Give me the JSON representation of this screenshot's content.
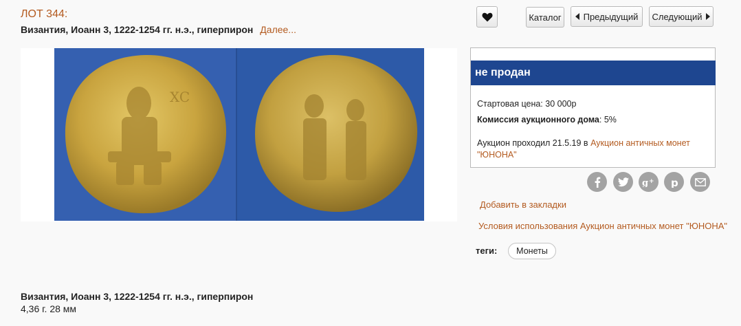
{
  "lot": {
    "number_label": "ЛОТ 344:",
    "title": "Византия, Иоанн 3, 1222-1254 гг. н.э., гиперпирон",
    "more_link": "Далее..."
  },
  "nav": {
    "catalog": "Каталог",
    "previous": "Предыдущий",
    "next": "Следующий",
    "favorite_icon": "heart-icon"
  },
  "status": {
    "label": "не продан",
    "start_price_label": "Стартовая цена:",
    "start_price_value": "30 000р",
    "commission_label": "Комиссия аукционного дома",
    "commission_value": ": 5%",
    "auction_text": "Аукцион проходил 21.5.19 в",
    "auction_link_line1": "Аукцион античных монет",
    "auction_link_line2": "\"ЮНОНА\""
  },
  "social": [
    "facebook-icon",
    "twitter-icon",
    "google-plus-icon",
    "pinterest-icon",
    "email-icon"
  ],
  "links": {
    "bookmark": "Добавить в закладки",
    "terms": "Условия использования Аукцион античных монет \"ЮНОНА\""
  },
  "tags": {
    "label": "теги:",
    "items": [
      "Монеты"
    ]
  },
  "description": {
    "title": "Византия, Иоанн 3, 1222-1254 гг. н.э., гиперпирон",
    "size": "4,36 г. 28 мм"
  },
  "colors": {
    "accent": "#b35a1f",
    "status_bar": "#1e4690",
    "photo_bg": "#2f5dab",
    "gold": "#c9a43f"
  }
}
